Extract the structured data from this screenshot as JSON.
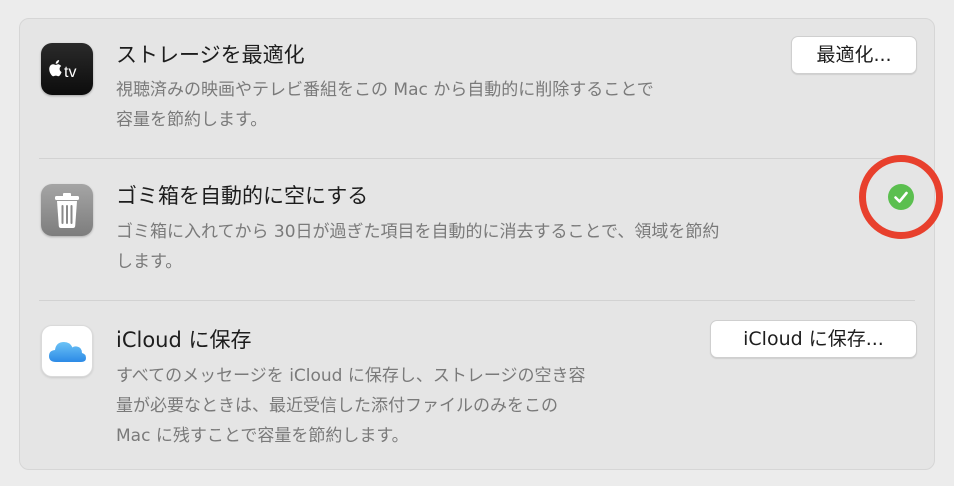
{
  "rows": [
    {
      "title": "ストレージを最適化",
      "desc_lines": [
        "視聴済みの映画やテレビ番組をこの Mac から自動的に削除することで",
        "容量を節約します。"
      ],
      "button_label": "最適化...",
      "icon": "tv-icon"
    },
    {
      "title": "ゴミ箱を自動的に空にする",
      "desc_lines": [
        "ゴミ箱に入れてから 30日が過ぎた項目を自動的に消去することで、領域を節約",
        "します。"
      ],
      "status": "enabled",
      "icon": "trash-icon"
    },
    {
      "title": "iCloud に保存",
      "desc_lines": [
        "すべてのメッセージを iCloud に保存し、ストレージの空き容",
        "量が必要なときは、最近受信した添付ファイルのみをこの",
        "Mac に残すことで容量を節約します。"
      ],
      "button_label": "iCloud に保存...",
      "icon": "cloud-icon"
    }
  ],
  "colors": {
    "check_green": "#5bbf4f",
    "annotation_red": "#e8402d"
  }
}
